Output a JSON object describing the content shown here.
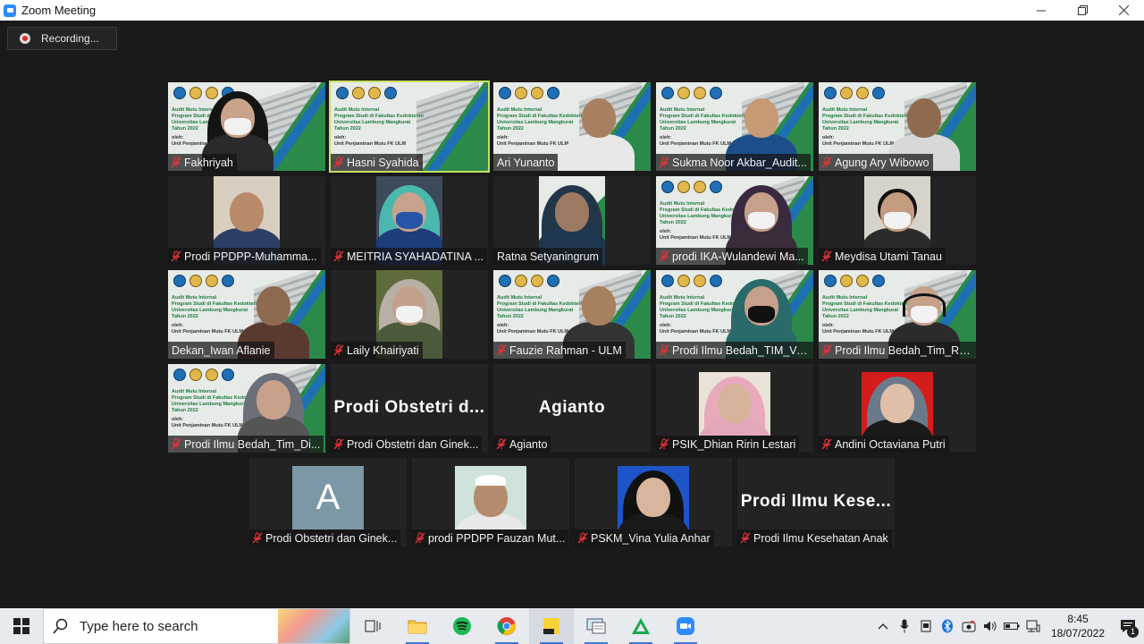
{
  "window": {
    "title": "Zoom Meeting",
    "minimize": "—",
    "restore": "❐",
    "close": "✕"
  },
  "recording": {
    "label": "Recording..."
  },
  "participants": [
    {
      "name": "Fakhriyah",
      "muted": true,
      "tile": "slide-person"
    },
    {
      "name": "Hasni Syahida",
      "muted": true,
      "tile": "slide",
      "active_speaker": true
    },
    {
      "name": "Ari Yunanto",
      "muted": false,
      "tile": "slide-person"
    },
    {
      "name": "Sukma Noor Akbar_Audit...",
      "muted": true,
      "tile": "slide-person"
    },
    {
      "name": "Agung Ary Wibowo",
      "muted": true,
      "tile": "slide-person"
    },
    {
      "name": "Prodi PPDPP-Muhamma...",
      "muted": true,
      "tile": "camera"
    },
    {
      "name": "MEITRIA SYAHADATINA ...",
      "muted": true,
      "tile": "camera"
    },
    {
      "name": "Ratna Setyaningrum",
      "muted": false,
      "tile": "camera"
    },
    {
      "name": "prodi IKA-Wulandewi Ma...",
      "muted": true,
      "tile": "slide-person"
    },
    {
      "name": "Meydisa Utami Tanau",
      "muted": true,
      "tile": "camera"
    },
    {
      "name": "Dekan_Iwan Aflanie",
      "muted": false,
      "tile": "slide-person"
    },
    {
      "name": "Laily Khairiyati",
      "muted": true,
      "tile": "camera"
    },
    {
      "name": "Fauzie Rahman - ULM",
      "muted": true,
      "tile": "slide-person"
    },
    {
      "name": "Prodi Ilmu Bedah_TIM_Ve...",
      "muted": true,
      "tile": "slide-person"
    },
    {
      "name": "Prodi Ilmu Bedah_Tim_Ru...",
      "muted": true,
      "tile": "slide-person"
    },
    {
      "name": "Prodi Ilmu Bedah_Tim_Di...",
      "muted": true,
      "tile": "slide-person"
    },
    {
      "name": "Prodi Obstetri dan Ginek...",
      "muted": true,
      "tile": "text",
      "display_text": "Prodi Obstetri d..."
    },
    {
      "name": "Agianto",
      "muted": true,
      "tile": "text",
      "display_text": "Agianto"
    },
    {
      "name": "PSIK_Dhian Ririn Lestari",
      "muted": true,
      "tile": "photo"
    },
    {
      "name": "Andini Octaviana Putri",
      "muted": true,
      "tile": "photo"
    },
    {
      "name": "Prodi Obstetri dan Ginek...",
      "muted": true,
      "tile": "avatar",
      "display_text": "A"
    },
    {
      "name": "prodi PPDPP Fauzan Mut...",
      "muted": true,
      "tile": "photo"
    },
    {
      "name": "PSKM_Vina Yulia Anhar",
      "muted": true,
      "tile": "photo"
    },
    {
      "name": "Prodi Ilmu Kesehatan Anak",
      "muted": true,
      "tile": "text",
      "display_text": "Prodi Ilmu Kese..."
    }
  ],
  "slide_text": {
    "title_lines": [
      "Audit Mutu Internal",
      "Program Studi di Fakultas Kedokteran",
      "Universitas Lambung Mangkurat",
      "Tahun 2022"
    ],
    "by": "oleh:",
    "unit": "Unit Penjaminan Mutu FK ULM"
  },
  "taskbar": {
    "search_placeholder": "Type here to search",
    "time": "8:45",
    "date": "18/07/2022",
    "notification_count": "1"
  },
  "colors": {
    "active_speaker": "#c8e060",
    "muted_mic": "#e0323a",
    "zoom_blue": "#2d8cff"
  }
}
